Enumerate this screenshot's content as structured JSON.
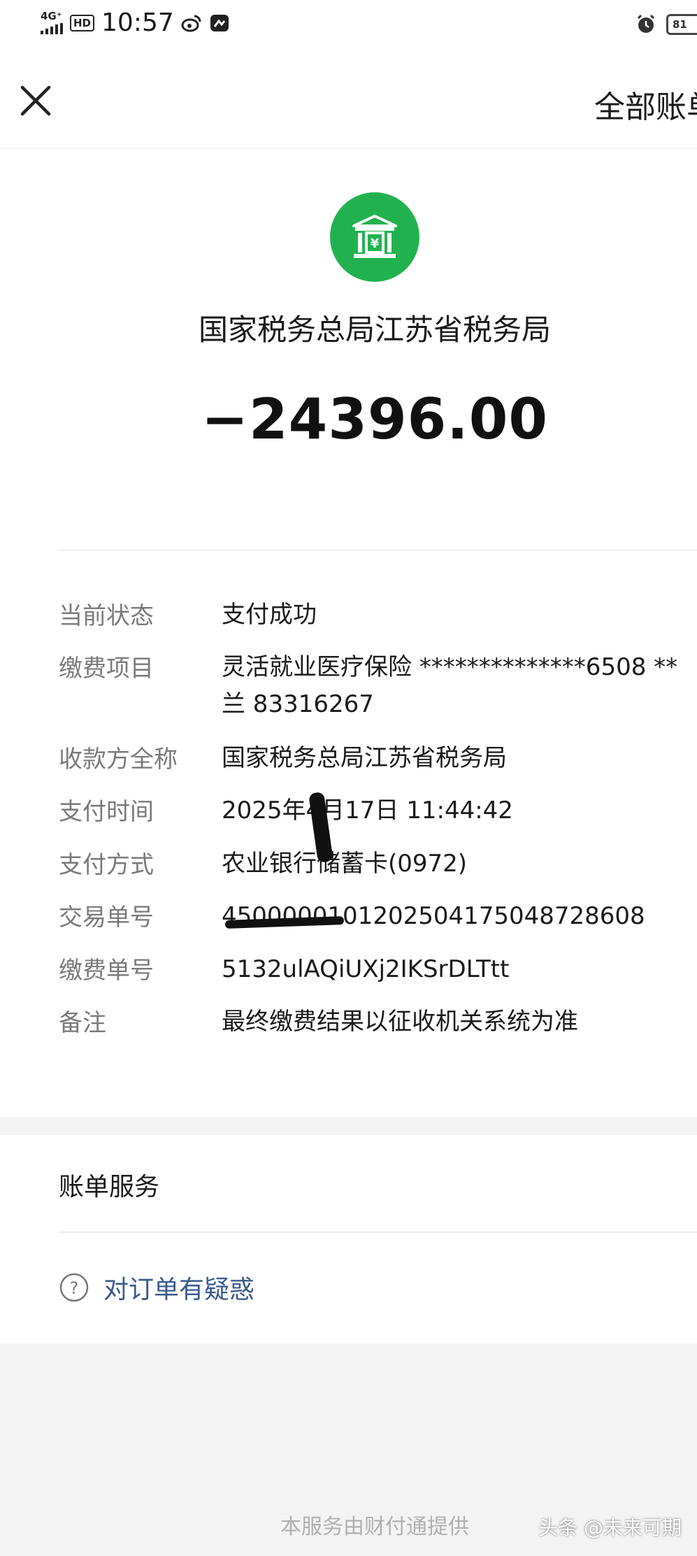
{
  "status_bar": {
    "network": "4G⁺",
    "hd": "HD",
    "time": "10:57",
    "battery": "81"
  },
  "nav": {
    "title": "全部账单"
  },
  "merchant": {
    "name": "国家税务总局江苏省税务局",
    "amount": "−24396.00",
    "logo_color": "#21b24f"
  },
  "details": [
    {
      "label": "当前状态",
      "value": "支付成功"
    },
    {
      "label": "缴费项目",
      "value": "灵活就业医疗保险 **************6508 **兰 83316267"
    },
    {
      "label": "收款方全称",
      "value": "国家税务总局江苏省税务局"
    },
    {
      "label": "支付时间",
      "value": "2025年4月17日 11:44:42"
    },
    {
      "label": "支付方式",
      "value": "农业银行储蓄卡(0972)"
    },
    {
      "label": "交易单号",
      "value": "4500000101202504175048728608"
    },
    {
      "label": "缴费单号",
      "value": "5132ulAQiUXj2IKSrDLTtt"
    },
    {
      "label": "备注",
      "value": "最终缴费结果以征收机关系统为准"
    }
  ],
  "service": {
    "title": "账单服务",
    "question_link": "对订单有疑惑"
  },
  "footer": {
    "provider": "本服务由财付通提供",
    "watermark": "头条 @未来可期"
  },
  "icons": {
    "close": "close-icon",
    "bank": "bank-icon",
    "question": "question-circle-icon"
  }
}
